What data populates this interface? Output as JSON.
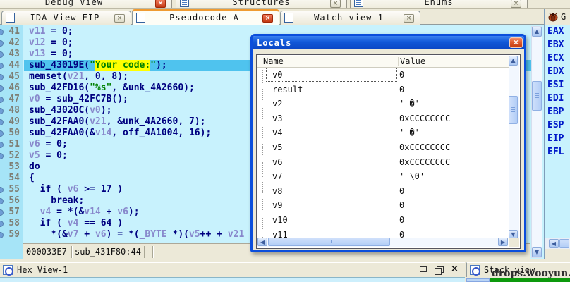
{
  "top_tabs": [
    {
      "label": "Debug View",
      "close": "red"
    },
    {
      "label": "Structures",
      "close": "gray"
    },
    {
      "label": "Enums",
      "close": "gray"
    }
  ],
  "tabs": [
    {
      "label": "IDA View-EIP",
      "active": false,
      "close": "gray"
    },
    {
      "label": "Pseudocode-A",
      "active": true,
      "close": "red"
    },
    {
      "label": "Watch view 1",
      "active": false,
      "close": "gray"
    }
  ],
  "registers_header": "G",
  "registers": [
    "EAX",
    "EBX",
    "ECX",
    "EDX",
    "ESI",
    "EDI",
    "EBP",
    "ESP",
    "EIP",
    "EFL"
  ],
  "code": {
    "lines": [
      {
        "num": "41",
        "dot": 1,
        "hl": 0,
        "seg": [
          [
            "v",
            "v11"
          ],
          [
            "k",
            " = 0;"
          ]
        ]
      },
      {
        "num": "42",
        "dot": 1,
        "hl": 0,
        "seg": [
          [
            "v",
            "v12"
          ],
          [
            "k",
            " = 0;"
          ]
        ]
      },
      {
        "num": "43",
        "dot": 1,
        "hl": 0,
        "seg": [
          [
            "v",
            "v13"
          ],
          [
            "k",
            " = 0;"
          ]
        ]
      },
      {
        "num": "44",
        "dot": 1,
        "hl": 1,
        "seg": [
          [
            "k",
            "sub_43019E("
          ],
          [
            "s",
            "\""
          ],
          [
            "sy",
            "Your code:"
          ],
          [
            "s",
            "\""
          ],
          [
            "k",
            ");"
          ]
        ]
      },
      {
        "num": "45",
        "dot": 1,
        "hl": 0,
        "seg": [
          [
            "k",
            "memset("
          ],
          [
            "v",
            "v21"
          ],
          [
            "k",
            ", 0, 8);"
          ]
        ]
      },
      {
        "num": "46",
        "dot": 1,
        "hl": 0,
        "seg": [
          [
            "k",
            "sub_42FD16("
          ],
          [
            "s",
            "\"%s\""
          ],
          [
            "k",
            ", &unk_4A2660);"
          ]
        ]
      },
      {
        "num": "47",
        "dot": 1,
        "hl": 0,
        "seg": [
          [
            "v",
            "v0"
          ],
          [
            "k",
            " = sub_42FC7B();"
          ]
        ]
      },
      {
        "num": "48",
        "dot": 1,
        "hl": 0,
        "seg": [
          [
            "k",
            "sub_43020C("
          ],
          [
            "v",
            "v0"
          ],
          [
            "k",
            ");"
          ]
        ]
      },
      {
        "num": "49",
        "dot": 1,
        "hl": 0,
        "seg": [
          [
            "k",
            "sub_42FAA0("
          ],
          [
            "v",
            "v21"
          ],
          [
            "k",
            ", &unk_4A2660, 7);"
          ]
        ]
      },
      {
        "num": "50",
        "dot": 1,
        "hl": 0,
        "seg": [
          [
            "k",
            "sub_42FAA0(&"
          ],
          [
            "v",
            "v14"
          ],
          [
            "k",
            ", off_4A1004, 16);"
          ]
        ]
      },
      {
        "num": "51",
        "dot": 1,
        "hl": 0,
        "seg": [
          [
            "v",
            "v6"
          ],
          [
            "k",
            " = 0;"
          ]
        ]
      },
      {
        "num": "52",
        "dot": 1,
        "hl": 0,
        "seg": [
          [
            "v",
            "v5"
          ],
          [
            "k",
            " = 0;"
          ]
        ]
      },
      {
        "num": "53",
        "dot": 0,
        "hl": 0,
        "seg": [
          [
            "k",
            "do"
          ]
        ]
      },
      {
        "num": "54",
        "dot": 0,
        "hl": 0,
        "seg": [
          [
            "k",
            "{"
          ]
        ]
      },
      {
        "num": "55",
        "dot": 1,
        "hl": 0,
        "seg": [
          [
            "k",
            "  if ( "
          ],
          [
            "v",
            "v6"
          ],
          [
            "k",
            " >= 17 )"
          ]
        ]
      },
      {
        "num": "56",
        "dot": 1,
        "hl": 0,
        "seg": [
          [
            "k",
            "    break;"
          ]
        ]
      },
      {
        "num": "57",
        "dot": 1,
        "hl": 0,
        "seg": [
          [
            "k",
            "  "
          ],
          [
            "v",
            "v4"
          ],
          [
            "k",
            " = *(&"
          ],
          [
            "v",
            "v14"
          ],
          [
            "k",
            " + "
          ],
          [
            "v",
            "v6"
          ],
          [
            "k",
            ");"
          ]
        ]
      },
      {
        "num": "58",
        "dot": 1,
        "hl": 0,
        "seg": [
          [
            "k",
            "  if ( "
          ],
          [
            "v",
            "v4"
          ],
          [
            "k",
            " == 64 )"
          ]
        ]
      },
      {
        "num": "59",
        "dot": 1,
        "hl": 0,
        "seg": [
          [
            "k",
            "    *(&"
          ],
          [
            "v",
            "v7"
          ],
          [
            "k",
            " + "
          ],
          [
            "v",
            "v6"
          ],
          [
            "k",
            ") = *("
          ],
          [
            "v",
            "_BYTE"
          ],
          [
            "k",
            " *)("
          ],
          [
            "v",
            "v5"
          ],
          [
            "k",
            "++ + "
          ],
          [
            "v",
            "v21"
          ]
        ]
      }
    ]
  },
  "status_cells": [
    "000033E7",
    "sub_431F80:44"
  ],
  "locals": {
    "title": "Locals",
    "columns": [
      "Name",
      "Value"
    ],
    "rows": [
      [
        "v0",
        "0"
      ],
      [
        "result",
        "0"
      ],
      [
        "v2",
        "' �'"
      ],
      [
        "v3",
        "0xCCCCCCCC"
      ],
      [
        "v4",
        "' �'"
      ],
      [
        "v5",
        "0xCCCCCCCC"
      ],
      [
        "v6",
        "0xCCCCCCCC"
      ],
      [
        "v7",
        "' \\0'"
      ],
      [
        "v8",
        "0"
      ],
      [
        "v9",
        "0"
      ],
      [
        "v10",
        "0"
      ],
      [
        "v11",
        "0"
      ]
    ]
  },
  "bottom": {
    "hex_title": "Hex View-1",
    "stack_title": "Stack view"
  },
  "watermark": "drops.wooyun.org",
  "colors": {
    "code_background": "#c8f2fd",
    "gutter_background": "#a6e4f7",
    "highlight_line": "#4fc3ee",
    "string_highlight": "#ffff00",
    "keyword_navy": "#000080",
    "variable_slate": "#8888cc",
    "string_green": "#008000",
    "register_blue": "#0018c8",
    "dialog_border_blue": "#0b4edc",
    "green_bar": "#0d990d",
    "active_tab_orange": "#ef9b32"
  }
}
